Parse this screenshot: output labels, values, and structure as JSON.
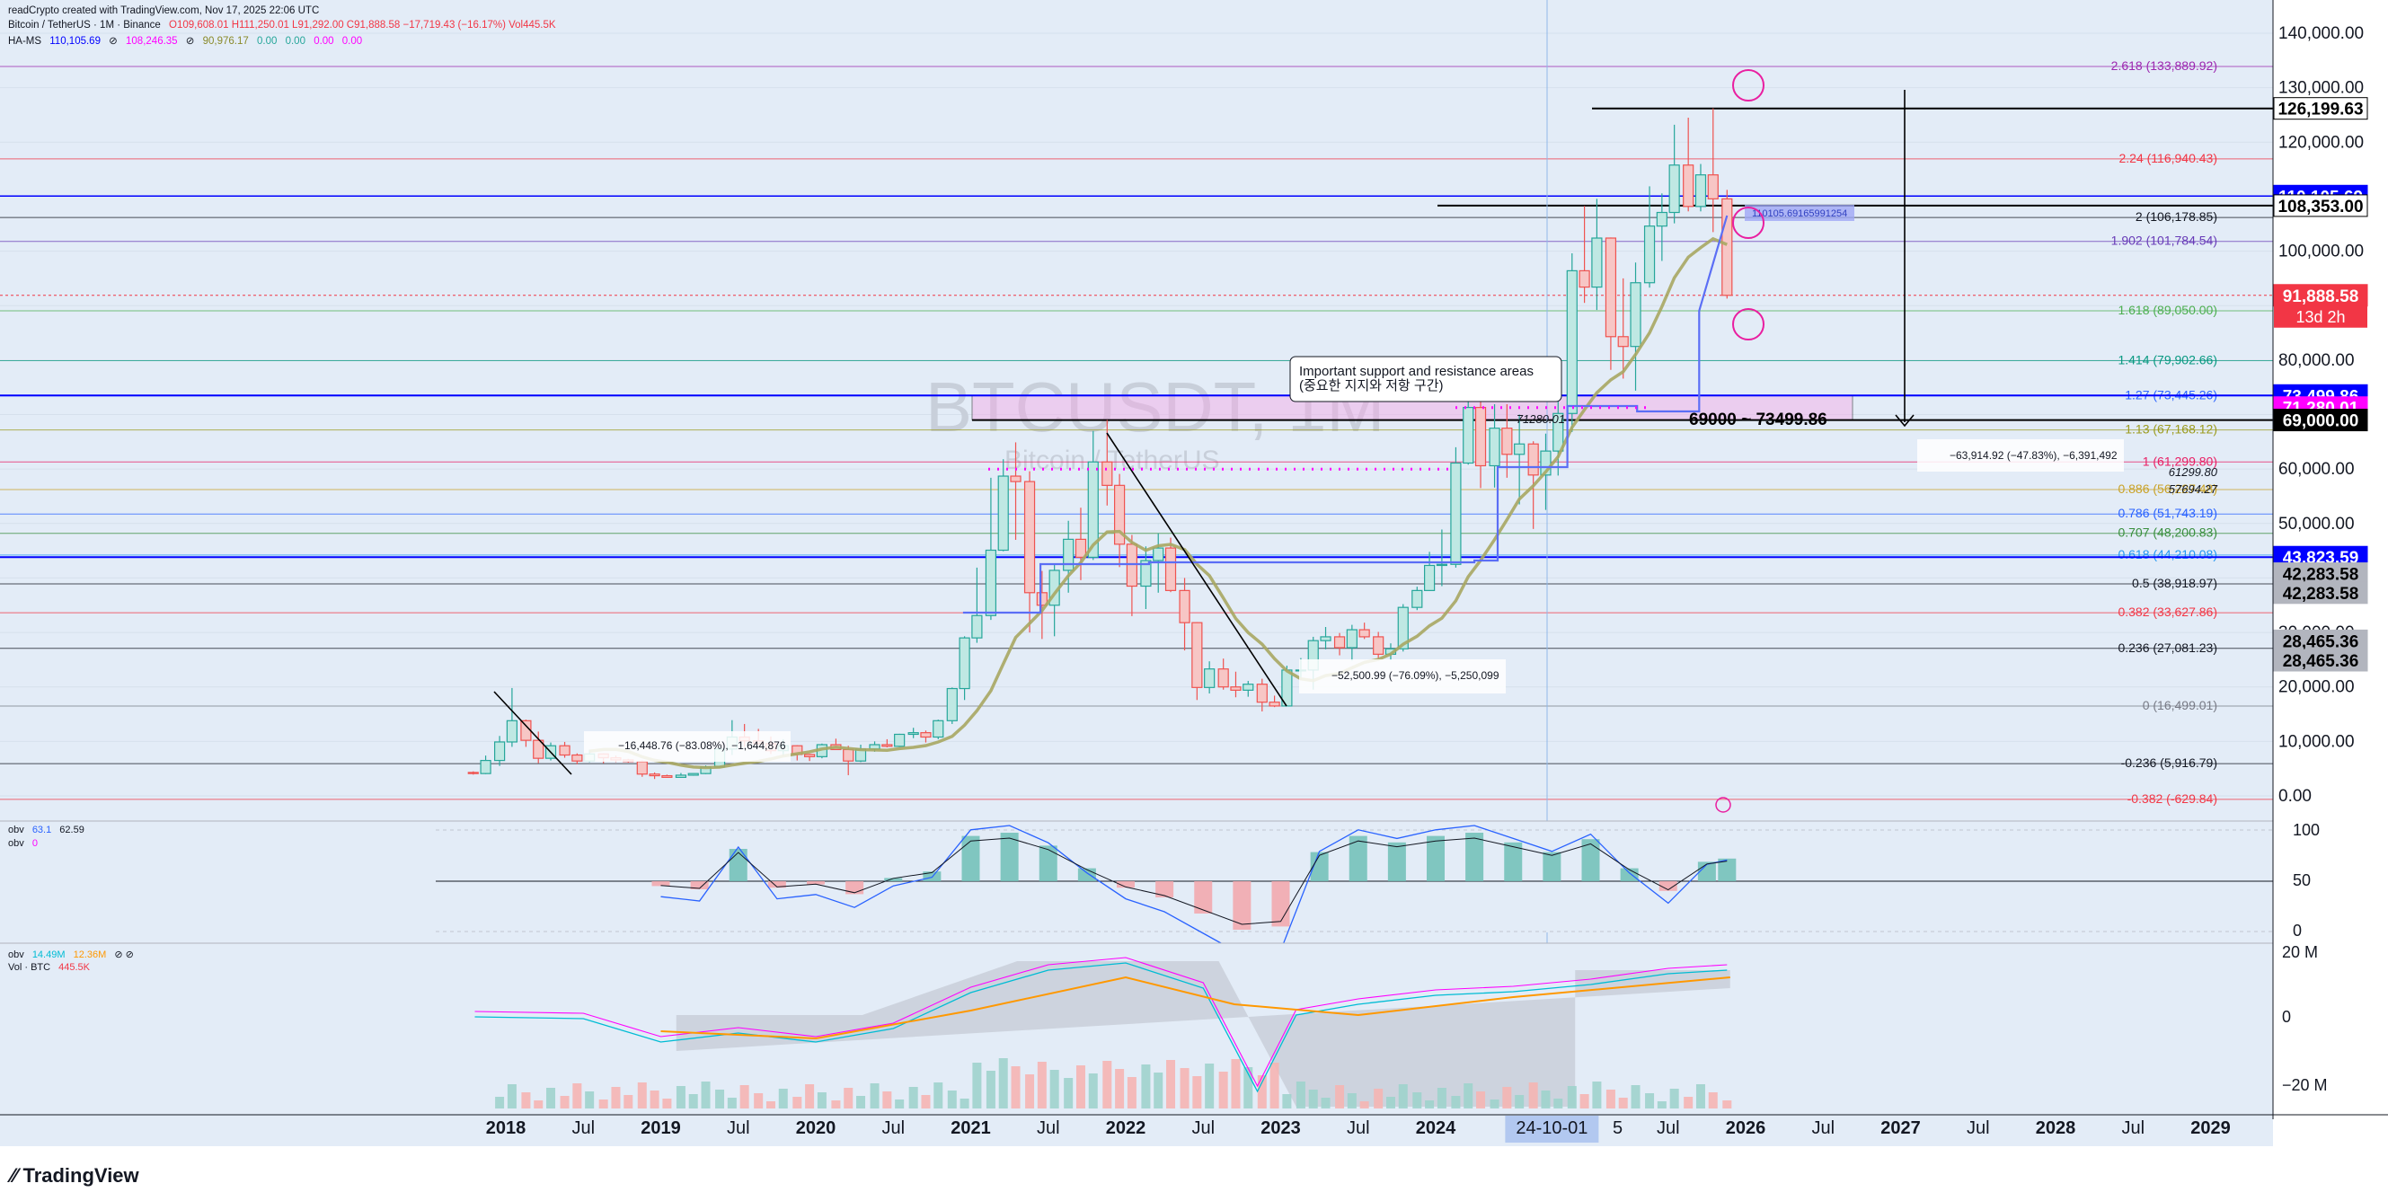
{
  "header": {
    "line1": "readCrypto created with TradingView.com, Nov 17, 2025 22:06 UTC",
    "symbol_line": "Bitcoin / TetherUS · 1M · Binance",
    "ohlc": "O109,608.01 H111,250.01 L91,292.00 C91,888.58 −17,719.43 (−16.17%) Vol445.5K",
    "hams_label": "HA-MS",
    "hams_values": [
      "110,105.69",
      "108,246.35",
      "90,976.17",
      "0.00",
      "0.00",
      "0.00",
      "0.00"
    ]
  },
  "watermark": {
    "main": "BTCUSDT, 1M",
    "sub": "Bitcoin / TetherUS"
  },
  "colors": {
    "up": "#26a69a",
    "down": "#ef5350",
    "blue_line": "#0000ff",
    "ma": "#a7a762",
    "magenta": "#ff00ff",
    "bg": "#e3ecf7",
    "price_red": "#f23645"
  },
  "chart_data": {
    "type": "candlestick",
    "price_axis_ticks": [
      "140,000.00",
      "130,000.00",
      "120,000.00",
      "110,000.00",
      "100,000.00",
      "90,000.00",
      "80,000.00",
      "70,000.00",
      "60,000.00",
      "50,000.00",
      "40,000.00",
      "30,000.00",
      "20,000.00",
      "10,000.00",
      "0.00"
    ],
    "time_axis_ticks": [
      "2018",
      "Jul",
      "2019",
      "Jul",
      "2020",
      "Jul",
      "2021",
      "Jul",
      "2022",
      "Jul",
      "2023",
      "Jul",
      "2024",
      "24-10-01",
      "5",
      "Jul",
      "2026",
      "Jul",
      "2027",
      "Jul",
      "2028",
      "Jul",
      "2029"
    ],
    "ylim": [
      -2000,
      145000
    ],
    "candles": [
      [
        2017.79,
        4300,
        4500,
        3900,
        4100
      ],
      [
        2017.87,
        4100,
        7400,
        4000,
        6500
      ],
      [
        2017.96,
        6500,
        11000,
        5500,
        9900
      ],
      [
        2018.04,
        9900,
        19800,
        9000,
        13800
      ],
      [
        2018.13,
        13800,
        14000,
        9000,
        10200
      ],
      [
        2018.21,
        10200,
        11800,
        6000,
        6900
      ],
      [
        2018.29,
        6900,
        9800,
        6500,
        9200
      ],
      [
        2018.38,
        9200,
        9900,
        7000,
        7500
      ],
      [
        2018.46,
        7500,
        7800,
        5800,
        6400
      ],
      [
        2018.54,
        6400,
        8500,
        6200,
        7700
      ],
      [
        2018.63,
        7700,
        7800,
        6000,
        7000
      ],
      [
        2018.71,
        7000,
        7400,
        6200,
        6600
      ],
      [
        2018.79,
        6600,
        6800,
        6100,
        6300
      ],
      [
        2018.88,
        6300,
        6500,
        3500,
        4000
      ],
      [
        2018.96,
        4000,
        4300,
        3100,
        3700
      ],
      [
        2019.04,
        3700,
        3900,
        3300,
        3400
      ],
      [
        2019.13,
        3400,
        4200,
        3300,
        3800
      ],
      [
        2019.21,
        3800,
        4100,
        3700,
        4100
      ],
      [
        2019.29,
        4100,
        5600,
        4000,
        5300
      ],
      [
        2019.38,
        5300,
        9000,
        5300,
        8600
      ],
      [
        2019.46,
        8600,
        13900,
        7500,
        10800
      ],
      [
        2019.54,
        10800,
        13200,
        9000,
        10100
      ],
      [
        2019.63,
        10100,
        12300,
        9300,
        9600
      ],
      [
        2019.71,
        9600,
        10900,
        7700,
        8300
      ],
      [
        2019.79,
        8300,
        10400,
        7300,
        9200
      ],
      [
        2019.88,
        9200,
        9300,
        6500,
        7600
      ],
      [
        2019.96,
        7600,
        7700,
        6400,
        7200
      ],
      [
        2020.04,
        7200,
        9600,
        6900,
        9400
      ],
      [
        2020.13,
        9400,
        10500,
        8500,
        8500
      ],
      [
        2020.21,
        8500,
        9200,
        3800,
        6400
      ],
      [
        2020.29,
        6400,
        9400,
        6200,
        8600
      ],
      [
        2020.38,
        8600,
        10000,
        8100,
        9400
      ],
      [
        2020.46,
        9400,
        10400,
        8900,
        9100
      ],
      [
        2020.54,
        9100,
        11400,
        9000,
        11300
      ],
      [
        2020.63,
        11300,
        12500,
        10600,
        11600
      ],
      [
        2020.71,
        11600,
        12000,
        9800,
        10800
      ],
      [
        2020.79,
        10800,
        14000,
        10400,
        13800
      ],
      [
        2020.88,
        13800,
        19900,
        13200,
        19700
      ],
      [
        2020.96,
        19700,
        29300,
        17600,
        29000
      ],
      [
        2021.04,
        29000,
        41900,
        28100,
        33100
      ],
      [
        2021.13,
        33100,
        58400,
        32300,
        45100
      ],
      [
        2021.21,
        45100,
        61800,
        44900,
        58700
      ],
      [
        2021.29,
        58700,
        64900,
        47000,
        57700
      ],
      [
        2021.38,
        57700,
        59600,
        30000,
        37300
      ],
      [
        2021.46,
        37300,
        41300,
        28800,
        35000
      ],
      [
        2021.54,
        35000,
        42600,
        29300,
        41400
      ],
      [
        2021.63,
        41400,
        50500,
        37300,
        47100
      ],
      [
        2021.71,
        47100,
        52900,
        39600,
        43800
      ],
      [
        2021.79,
        43800,
        67000,
        43300,
        61300
      ],
      [
        2021.88,
        61300,
        69000,
        53300,
        57000
      ],
      [
        2021.96,
        57000,
        59100,
        42000,
        46200
      ],
      [
        2022.04,
        46200,
        47900,
        33000,
        38500
      ],
      [
        2022.13,
        38500,
        45800,
        34300,
        43200
      ],
      [
        2022.21,
        43200,
        48200,
        37300,
        45500
      ],
      [
        2022.29,
        45500,
        47400,
        37400,
        37700
      ],
      [
        2022.38,
        37700,
        40000,
        26700,
        31800
      ],
      [
        2022.46,
        31800,
        31900,
        17600,
        19900
      ],
      [
        2022.54,
        19900,
        24700,
        18800,
        23300
      ],
      [
        2022.63,
        23300,
        25200,
        19500,
        20000
      ],
      [
        2022.71,
        20000,
        22800,
        18100,
        19400
      ],
      [
        2022.79,
        19400,
        21100,
        18200,
        20500
      ],
      [
        2022.88,
        20500,
        21500,
        15500,
        17200
      ],
      [
        2022.96,
        17200,
        18400,
        16300,
        16500
      ],
      [
        2023.04,
        16500,
        23900,
        16500,
        23100
      ],
      [
        2023.13,
        23100,
        25300,
        21300,
        23100
      ],
      [
        2023.21,
        23100,
        29200,
        19500,
        28500
      ],
      [
        2023.29,
        28500,
        31000,
        26900,
        29200
      ],
      [
        2023.38,
        29200,
        29900,
        25800,
        27200
      ],
      [
        2023.46,
        27200,
        31400,
        24800,
        30500
      ],
      [
        2023.54,
        30500,
        31800,
        28800,
        29200
      ],
      [
        2023.63,
        29200,
        30100,
        25200,
        26000
      ],
      [
        2023.71,
        26000,
        28000,
        24900,
        27000
      ],
      [
        2023.79,
        27000,
        35200,
        26500,
        34600
      ],
      [
        2023.88,
        34600,
        38400,
        34100,
        37700
      ],
      [
        2023.96,
        37700,
        44800,
        37600,
        42300
      ],
      [
        2024.04,
        42300,
        48900,
        38500,
        42500
      ],
      [
        2024.13,
        42500,
        64000,
        41900,
        61100
      ],
      [
        2024.21,
        61100,
        73800,
        60800,
        71300
      ],
      [
        2024.29,
        71300,
        72800,
        56500,
        60600
      ],
      [
        2024.38,
        60600,
        71900,
        56600,
        67500
      ],
      [
        2024.46,
        67500,
        71900,
        58400,
        62700
      ],
      [
        2024.54,
        62700,
        70000,
        53500,
        64600
      ],
      [
        2024.63,
        64600,
        65100,
        49000,
        58900
      ],
      [
        2024.71,
        58900,
        66500,
        52500,
        63300
      ],
      [
        2024.79,
        63300,
        73600,
        58800,
        70200
      ],
      [
        2024.88,
        70200,
        99600,
        66800,
        96400
      ],
      [
        2024.96,
        96400,
        108300,
        90500,
        93400
      ],
      [
        2025.04,
        93400,
        109600,
        89200,
        102400
      ],
      [
        2025.13,
        102400,
        102500,
        78200,
        84300
      ],
      [
        2025.21,
        84300,
        95000,
        76600,
        82500
      ],
      [
        2025.29,
        82500,
        97900,
        74400,
        94200
      ],
      [
        2025.38,
        94200,
        111900,
        93300,
        104600
      ],
      [
        2025.46,
        104600,
        110600,
        98200,
        107100
      ],
      [
        2025.54,
        107100,
        123200,
        105100,
        115800
      ],
      [
        2025.63,
        115800,
        124500,
        107300,
        108200
      ],
      [
        2025.71,
        108200,
        116000,
        107300,
        114000
      ],
      [
        2025.79,
        114000,
        126200,
        103500,
        109600
      ],
      [
        2025.88,
        109600,
        111250,
        91292,
        91888
      ]
    ],
    "fib_levels": [
      {
        "label": "2.618 (133,889.92)",
        "value": 133889.92,
        "color": "#9c27b0"
      },
      {
        "label": "2.24 (116,940.43)",
        "value": 116940.43,
        "color": "#f23645"
      },
      {
        "label": "2 (106,178.85)",
        "value": 106178.85,
        "color": "#131722"
      },
      {
        "label": "1.902 (101,784.54)",
        "value": 101784.54,
        "color": "#673ab7"
      },
      {
        "label": "1.618 (89,050.00)",
        "value": 89050.0,
        "color": "#4caf50"
      },
      {
        "label": "1.414 (79,902.66)",
        "value": 79902.66,
        "color": "#089981"
      },
      {
        "label": "1.27 (73,445.26)",
        "value": 73445.26,
        "color": "#2962ff"
      },
      {
        "label": "1.13 (67,168.12)",
        "value": 67168.12,
        "color": "#9b9b1f"
      },
      {
        "label": "1 (61,299.80)",
        "value": 61299.8,
        "color": "#e91e63"
      },
      {
        "label": "0.886 (56,227.48)",
        "value": 56227.48,
        "color": "#c9a227"
      },
      {
        "label": "0.786 (51,743.19)",
        "value": 51743.19,
        "color": "#2962ff"
      },
      {
        "label": "0.707 (48,200.83)",
        "value": 48200.83,
        "color": "#388e3c"
      },
      {
        "label": "0.618 (44,210.08)",
        "value": 44210.08,
        "color": "#2196f3"
      },
      {
        "label": "0.5 (38,918.97)",
        "value": 38918.97,
        "color": "#131722"
      },
      {
        "label": "0.382 (33,627.86)",
        "value": 33627.86,
        "color": "#f23645"
      },
      {
        "label": "0.236 (27,081.23)",
        "value": 27081.23,
        "color": "#131722"
      },
      {
        "label": "0 (16,499.01)",
        "value": 16499.01,
        "color": "#787b86"
      },
      {
        "label": "-0.236 (5,916.79)",
        "value": 5916.79,
        "color": "#131722"
      },
      {
        "label": "-0.382 (-629.84)",
        "value": -629.84,
        "color": "#f23645"
      }
    ],
    "price_labels": [
      {
        "text": "126,199.63",
        "value": 126199.63,
        "bg": "#ffffff",
        "fg": "#000000",
        "border": "#000000"
      },
      {
        "text": "110,105.69",
        "value": 110105.69,
        "bg": "#0000ff",
        "fg": "#ffffff"
      },
      {
        "text": "108,353.00",
        "value": 108353.0,
        "bg": "#ffffff",
        "fg": "#000000",
        "border": "#000000"
      },
      {
        "text": "91,888.58",
        "value": 91888.58,
        "bg": "#f23645",
        "fg": "#ffffff"
      },
      {
        "text": "73,499.86",
        "value": 73499.86,
        "bg": "#0000ff",
        "fg": "#ffffff"
      },
      {
        "text": "71,280.01",
        "value": 71280.01,
        "bg": "#ff00ff",
        "fg": "#ffffff"
      },
      {
        "text": "69,000.00",
        "value": 69000.0,
        "bg": "#000000",
        "fg": "#ffffff"
      },
      {
        "text": "43,823.59",
        "value": 43823.59,
        "bg": "#0000ff",
        "fg": "#ffffff"
      },
      {
        "text": "42,283.58",
        "value": 40800,
        "bg": "#b2b5be",
        "fg": "#000000"
      },
      {
        "text": "42,283.58",
        "value": 37300,
        "bg": "#b2b5be",
        "fg": "#000000"
      },
      {
        "text": "28,465.36",
        "value": 28465.36,
        "bg": "#b2b5be",
        "fg": "#000000"
      },
      {
        "text": "28,465.36",
        "value": 24900,
        "bg": "#b2b5be",
        "fg": "#000000"
      }
    ],
    "countdown": "13d 2h",
    "annotations": {
      "callout_line1": "Important support and resistance areas",
      "callout_line2": "(중요한 지지와 저항 구간)",
      "zone_label": "69000 ~ 73499.86",
      "label_71280": "71280.01",
      "label_61299": "61299.80",
      "label_57694": "57694.27",
      "measure1": "−16,448.76 (−83.08%), −1,644,876",
      "measure2": "−52,500.99 (−76.09%), −5,250,099",
      "measure3": "−63,914.92 (−47.83%), −6,391,492",
      "hl_value": "110105.69165991254"
    },
    "osc1": {
      "label": "obv",
      "v1": "63.1",
      "v2": "62.59",
      "label2": "obv",
      "v3": "0",
      "ticks": [
        "100",
        "50",
        "0"
      ]
    },
    "osc2": {
      "label": "obv",
      "v1": "14.49M",
      "v2": "12.36M",
      "vol_label": "Vol · BTC",
      "vol_value": "445.5K",
      "ticks": [
        "20 M",
        "0",
        "−20 M"
      ]
    }
  },
  "footer": {
    "brand": "TradingView"
  }
}
